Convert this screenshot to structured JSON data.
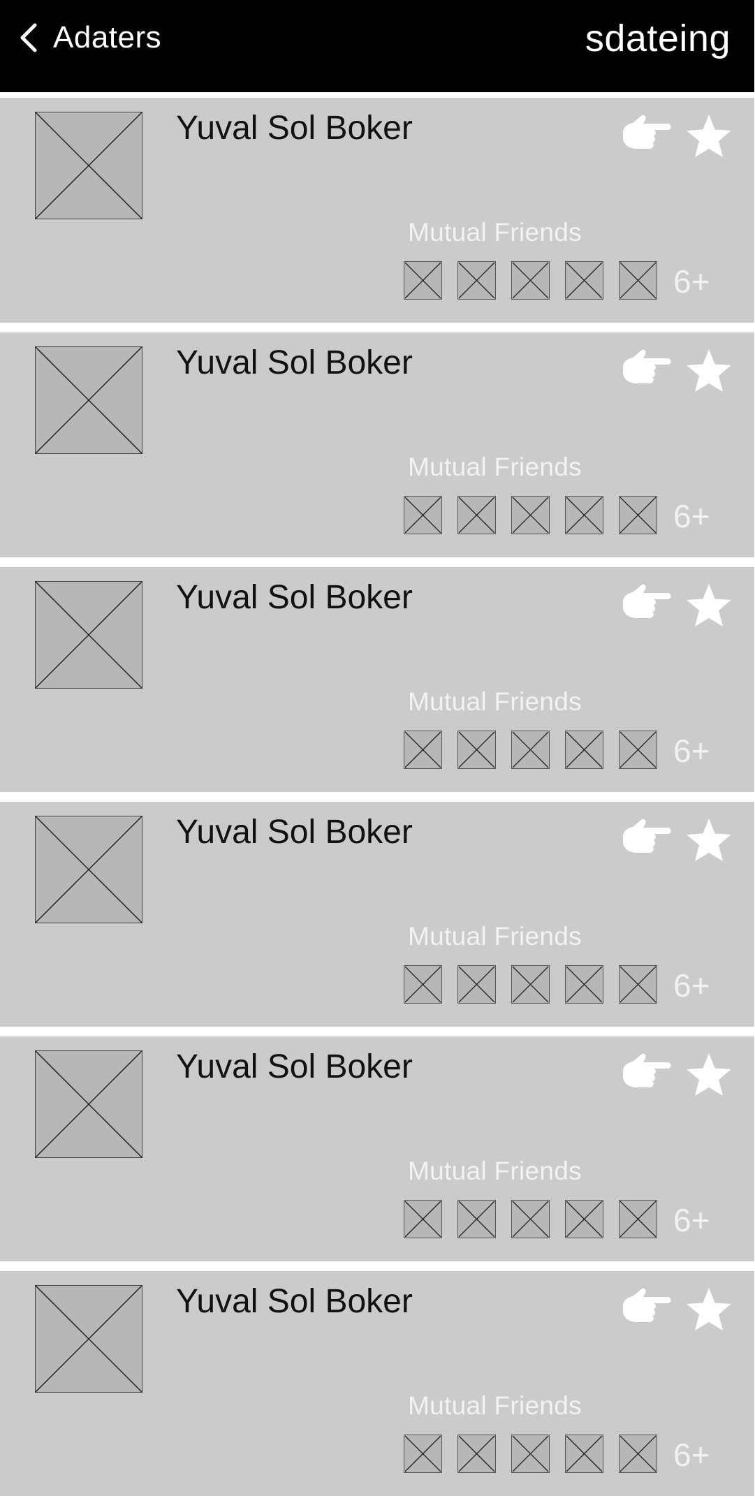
{
  "header": {
    "back_label": "Adaters",
    "brand": "sdateing"
  },
  "list": {
    "items": [
      {
        "name": "Yuval Sol Boker",
        "mutual_label": "Mutual Friends",
        "more_count": "6+"
      },
      {
        "name": "Yuval Sol Boker",
        "mutual_label": "Mutual Friends",
        "more_count": "6+"
      },
      {
        "name": "Yuval Sol Boker",
        "mutual_label": "Mutual Friends",
        "more_count": "6+"
      },
      {
        "name": "Yuval Sol Boker",
        "mutual_label": "Mutual Friends",
        "more_count": "6+"
      },
      {
        "name": "Yuval Sol Boker",
        "mutual_label": "Mutual Friends",
        "more_count": "6+"
      },
      {
        "name": "Yuval Sol Boker",
        "mutual_label": "Mutual Friends",
        "more_count": "6+"
      }
    ]
  },
  "icons": {
    "back": "chevron-left-icon",
    "poke": "pointing-hand-icon",
    "favorite": "star-icon",
    "placeholder": "image-placeholder-icon"
  },
  "colors": {
    "header_bg": "#000000",
    "card_bg": "#cbcbcb",
    "placeholder_bg": "#b7b7b7",
    "light_text": "#f2f2f2"
  }
}
